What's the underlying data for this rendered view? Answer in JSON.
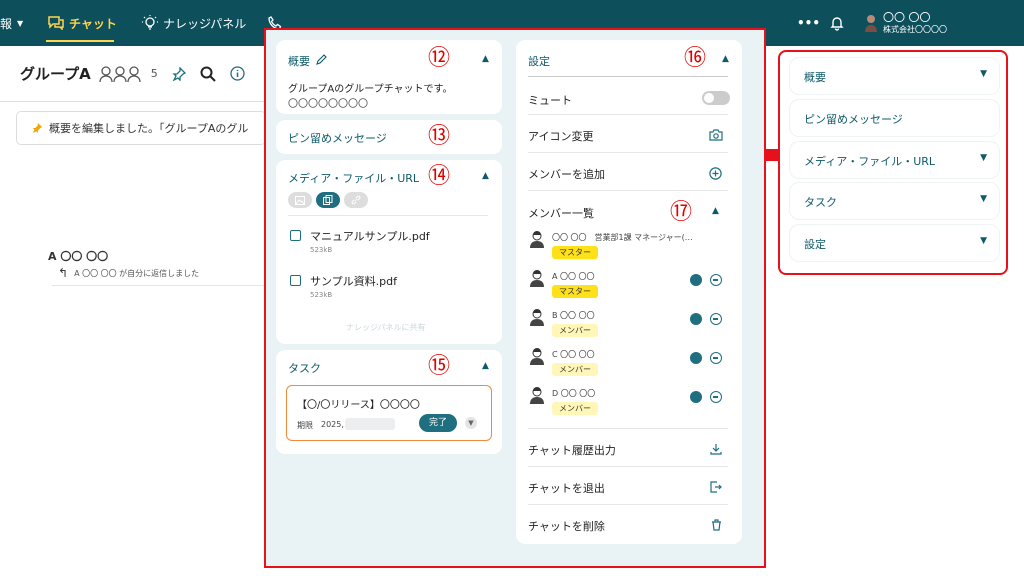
{
  "topbar": {
    "partial_label": "報",
    "chat_label": "チャット",
    "knowledge_label": "ナレッジパネル",
    "more": "•••",
    "user_name": "〇〇 〇〇",
    "user_company": "株式会社〇〇〇〇"
  },
  "group": {
    "title": "グループA",
    "member_count": "5"
  },
  "notice": {
    "text": "概要を編集しました。「グループAのグル"
  },
  "message": {
    "sender": "A 〇〇 〇〇",
    "reply_text": "A 〇〇 〇〇 が自分に返信しました"
  },
  "overview": {
    "title": "概要",
    "text1": "グループAのグループチャットです。",
    "text2": "〇〇〇〇〇〇〇〇",
    "marker": "⑫"
  },
  "pinned": {
    "title": "ピン留めメッセージ",
    "marker": "⑬"
  },
  "media": {
    "title": "メディア・ファイル・URL",
    "marker": "⑭",
    "files": [
      {
        "name": "マニュアルサンプル.pdf",
        "size": "523kB"
      },
      {
        "name": "サンプル資料.pdf",
        "size": "523kB"
      }
    ],
    "share_label": "ナレッジパネルに共有"
  },
  "task": {
    "title": "タスク",
    "marker": "⑮",
    "name": "【〇/〇リリース】〇〇〇〇",
    "deadline_label": "期限",
    "deadline_value": "2025,",
    "done_label": "完了"
  },
  "settings": {
    "title": "設定",
    "marker": "⑯",
    "mute": "ミュート",
    "icon_change": "アイコン変更",
    "add_member": "メンバーを追加",
    "member_list": "メンバー一覧",
    "member_marker": "⑰",
    "members": [
      {
        "name": "〇〇 〇〇　営業部1課 マネージャー(…",
        "role": "マスター",
        "type": "master"
      },
      {
        "name": "A 〇〇 〇〇",
        "role": "マスター",
        "type": "master"
      },
      {
        "name": "B 〇〇 〇〇",
        "role": "メンバー",
        "type": "member"
      },
      {
        "name": "C 〇〇 〇〇",
        "role": "メンバー",
        "type": "member"
      },
      {
        "name": "D 〇〇 〇〇",
        "role": "メンバー",
        "type": "member"
      }
    ],
    "export": "チャット履歴出力",
    "leave": "チャットを退出",
    "delete": "チャットを削除"
  },
  "right_panel": [
    {
      "label": "概要",
      "chevron": true
    },
    {
      "label": "ピン留めメッセージ",
      "chevron": false
    },
    {
      "label": "メディア・ファイル・URL",
      "chevron": true
    },
    {
      "label": "タスク",
      "chevron": true
    },
    {
      "label": "設定",
      "chevron": true
    }
  ],
  "colors": {
    "topbar": "#0e4f5c",
    "accent": "#ffd64d",
    "highlight": "#e8101a",
    "panel_bg": "#e9f2f4",
    "teal": "#1f6f80"
  }
}
